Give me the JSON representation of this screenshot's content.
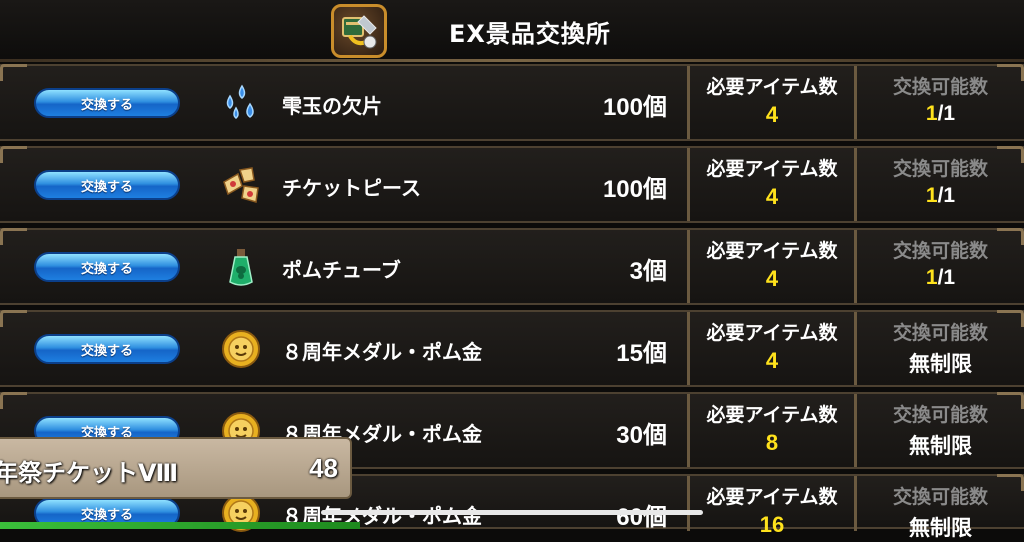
{
  "header": {
    "title": "EX景品交換所",
    "icon": "shop-exchange-icon"
  },
  "labels": {
    "exchange_button": "交換する",
    "required_items": "必要アイテム数",
    "exchangeable": "交換可能数"
  },
  "rows": [
    {
      "icon": "blue-gem-shards-icon",
      "name": "雫玉の欠片",
      "qty": "100個",
      "required": "4",
      "possible_current": "1",
      "possible_total": "/1",
      "unlimited": ""
    },
    {
      "icon": "ticket-pieces-icon",
      "name": "チケットピース",
      "qty": "100個",
      "required": "4",
      "possible_current": "1",
      "possible_total": "/1",
      "unlimited": ""
    },
    {
      "icon": "green-potion-tube-icon",
      "name": "ポムチューブ",
      "qty": "3個",
      "required": "4",
      "possible_current": "1",
      "possible_total": "/1",
      "unlimited": ""
    },
    {
      "icon": "gold-medal-icon",
      "name": "８周年メダル・ポム金",
      "qty": "15個",
      "required": "4",
      "possible_current": "",
      "possible_total": "",
      "unlimited": "無制限"
    },
    {
      "icon": "gold-medal-icon",
      "name": "８周年メダル・ポム金",
      "qty": "30個",
      "required": "8",
      "possible_current": "",
      "possible_total": "",
      "unlimited": "無制限"
    },
    {
      "icon": "gold-medal-icon",
      "name": "８周年メダル・ポム金",
      "qty": "60個",
      "required": "16",
      "possible_current": "",
      "possible_total": "",
      "unlimited": "無制限"
    }
  ],
  "ticket": {
    "name": "年祭チケットⅧ",
    "count": "48"
  },
  "colors": {
    "accent_yellow": "#ffe21c",
    "button_blue": "#1e7fe0",
    "frame_brown": "#6b5a40"
  }
}
